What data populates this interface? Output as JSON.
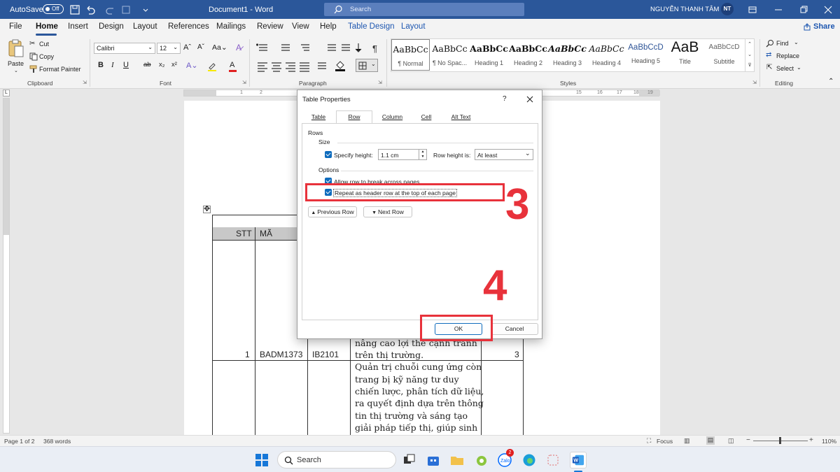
{
  "titlebar": {
    "autosave_label": "AutoSave",
    "autosave_state": "Off",
    "document_title": "Document1 - Word",
    "search_placeholder": "Search",
    "user_name": "NGUYỄN THANH TÂM",
    "user_initials": "NT"
  },
  "tabs": [
    "File",
    "Home",
    "Insert",
    "Design",
    "Layout",
    "References",
    "Mailings",
    "Review",
    "View",
    "Help",
    "Table Design",
    "Layout"
  ],
  "share_label": "Share",
  "ribbon": {
    "clipboard": {
      "paste": "Paste",
      "cut": "Cut",
      "copy": "Copy",
      "format_painter": "Format Painter",
      "label": "Clipboard"
    },
    "font": {
      "name": "Calibri",
      "size": "12",
      "label": "Font",
      "bold": "B",
      "italic": "I",
      "underline": "U",
      "strike": "ab",
      "sub": "x₂",
      "sup": "x²",
      "clear": "A"
    },
    "paragraph": {
      "label": "Paragraph"
    },
    "styles": {
      "label": "Styles",
      "items": [
        {
          "preview": "AaBbCc",
          "name": "¶ Normal"
        },
        {
          "preview": "AaBbCc",
          "name": "¶ No Spac..."
        },
        {
          "preview": "AaBbCc",
          "name": "Heading 1"
        },
        {
          "preview": "AaBbCc",
          "name": "Heading 2"
        },
        {
          "preview": "AaBbCc",
          "name": "Heading 3"
        },
        {
          "preview": "AaBbCc",
          "name": "Heading 4"
        },
        {
          "preview": "AaBbCcD",
          "name": "Heading 5"
        },
        {
          "preview": "AaB",
          "name": "Title"
        },
        {
          "preview": "AaBbCcD",
          "name": "Subtitle"
        }
      ]
    },
    "editing": {
      "find": "Find",
      "replace": "Replace",
      "select": "Select",
      "label": "Editing"
    }
  },
  "ruler_marks": [
    "1",
    "2",
    "15",
    "16",
    "17",
    "18",
    "19"
  ],
  "table": {
    "headers": [
      "STT",
      "MÃ"
    ],
    "row1": {
      "stt": "1",
      "code": "BADM1373",
      "class": "IB2101",
      "desc": [
        "nâng cao lợi thế cạnh tranh",
        "trên thị trường."
      ],
      "credits": "3"
    },
    "row2": {
      "desc": [
        "Quản trị chuỗi cung ứng còn",
        "trang bị kỹ năng tư duy",
        "chiến lược, phân tích dữ liệu,",
        "ra quyết định dựa trên thông",
        "tin thị trường và sáng tạo",
        "giải pháp tiếp thị, giúp sinh"
      ]
    }
  },
  "dialog": {
    "title": "Table Properties",
    "help": "?",
    "tabs": [
      "Table",
      "Row",
      "Column",
      "Cell",
      "Alt Text"
    ],
    "active_tab": "Row",
    "section_rows": "Rows",
    "section_size": "Size",
    "specify_height_label": "Specify height:",
    "height_value": "1.1 cm",
    "row_height_is_label": "Row height is:",
    "row_height_is_value": "At least",
    "section_options": "Options",
    "allow_break_label": "Allow row to break across pages",
    "repeat_header_label": "Repeat as header row at the top of each page",
    "prev_row": "Previous Row",
    "next_row": "Next Row",
    "ok": "OK",
    "cancel": "Cancel",
    "specify_height_checked": true,
    "allow_break_checked": true,
    "repeat_header_checked": true
  },
  "annotations": {
    "step3": "3",
    "step4": "4",
    "color": "#e8323b"
  },
  "status": {
    "page": "Page 1 of 2",
    "words": "368 words",
    "focus": "Focus",
    "zoom": "110%"
  },
  "taskbar": {
    "search": "Search",
    "badge": "2"
  }
}
